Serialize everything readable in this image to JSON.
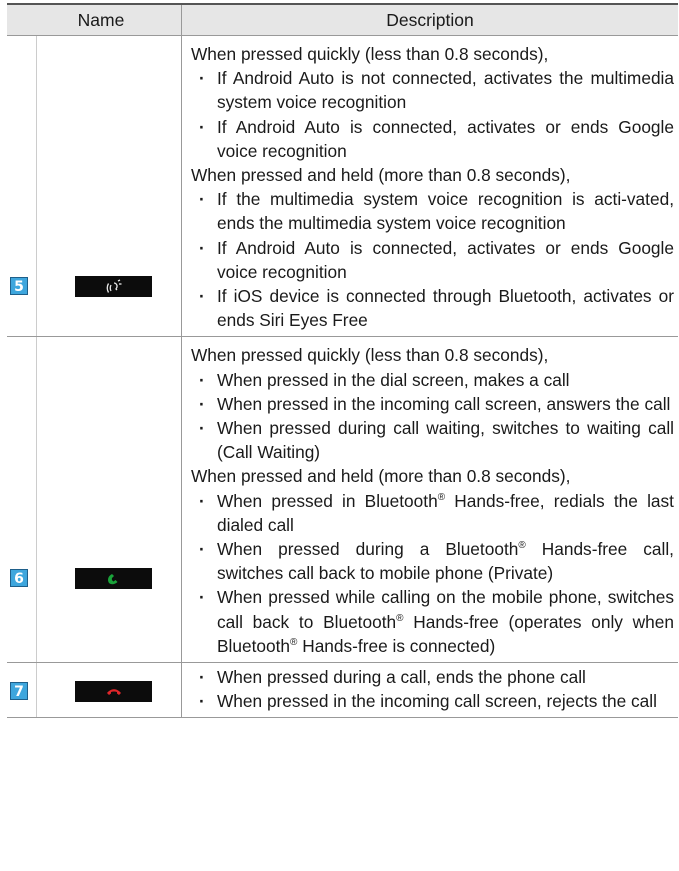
{
  "header": {
    "name": "Name",
    "description": "Description"
  },
  "rows": [
    {
      "number": "5",
      "icon": "voice-recognition-icon",
      "groups": [
        {
          "lead": "When pressed quickly (less than 0.8 seconds),",
          "bullets": [
            "If Android Auto is not connected, activates the multimedia system voice recognition",
            "If Android Auto is connected, activates or ends Google voice recognition"
          ]
        },
        {
          "lead": "When pressed and held (more than 0.8 seconds),",
          "bullets": [
            "If the multimedia system voice recognition is acti-vated, ends the multimedia system voice recognition",
            "If Android Auto is connected, activates or ends Google voice recognition",
            "If iOS device is connected through Bluetooth, activates or ends Siri Eyes Free"
          ]
        }
      ]
    },
    {
      "number": "6",
      "icon": "call-answer-icon",
      "groups": [
        {
          "lead": "When pressed quickly (less than 0.8 seconds),",
          "bullets": [
            "When pressed in the dial screen, makes a call",
            "When pressed in the incoming call screen, answers the call",
            "When pressed during call waiting, switches to waiting call (Call Waiting)"
          ]
        },
        {
          "lead": "When pressed and held (more than 0.8 seconds),",
          "bullets": [
            "When pressed in Bluetooth® Hands-free, redials the last dialed call",
            "When pressed during a Bluetooth® Hands-free call, switches call back to mobile phone (Private)",
            "When pressed while calling on the mobile phone, switches call back to Bluetooth® Hands-free (operates only when Bluetooth® Hands-free is connected)"
          ]
        }
      ]
    },
    {
      "number": "7",
      "icon": "call-end-icon",
      "groups": [
        {
          "lead": "",
          "bullets": [
            "When pressed during a call, ends the phone call",
            "When pressed in the incoming call screen, rejects the call"
          ]
        }
      ]
    }
  ],
  "colors": {
    "badge": "#3ea6dd",
    "answer_icon": "#1aa33a",
    "end_icon": "#e0262a",
    "header_bg": "#e6e6e6"
  }
}
